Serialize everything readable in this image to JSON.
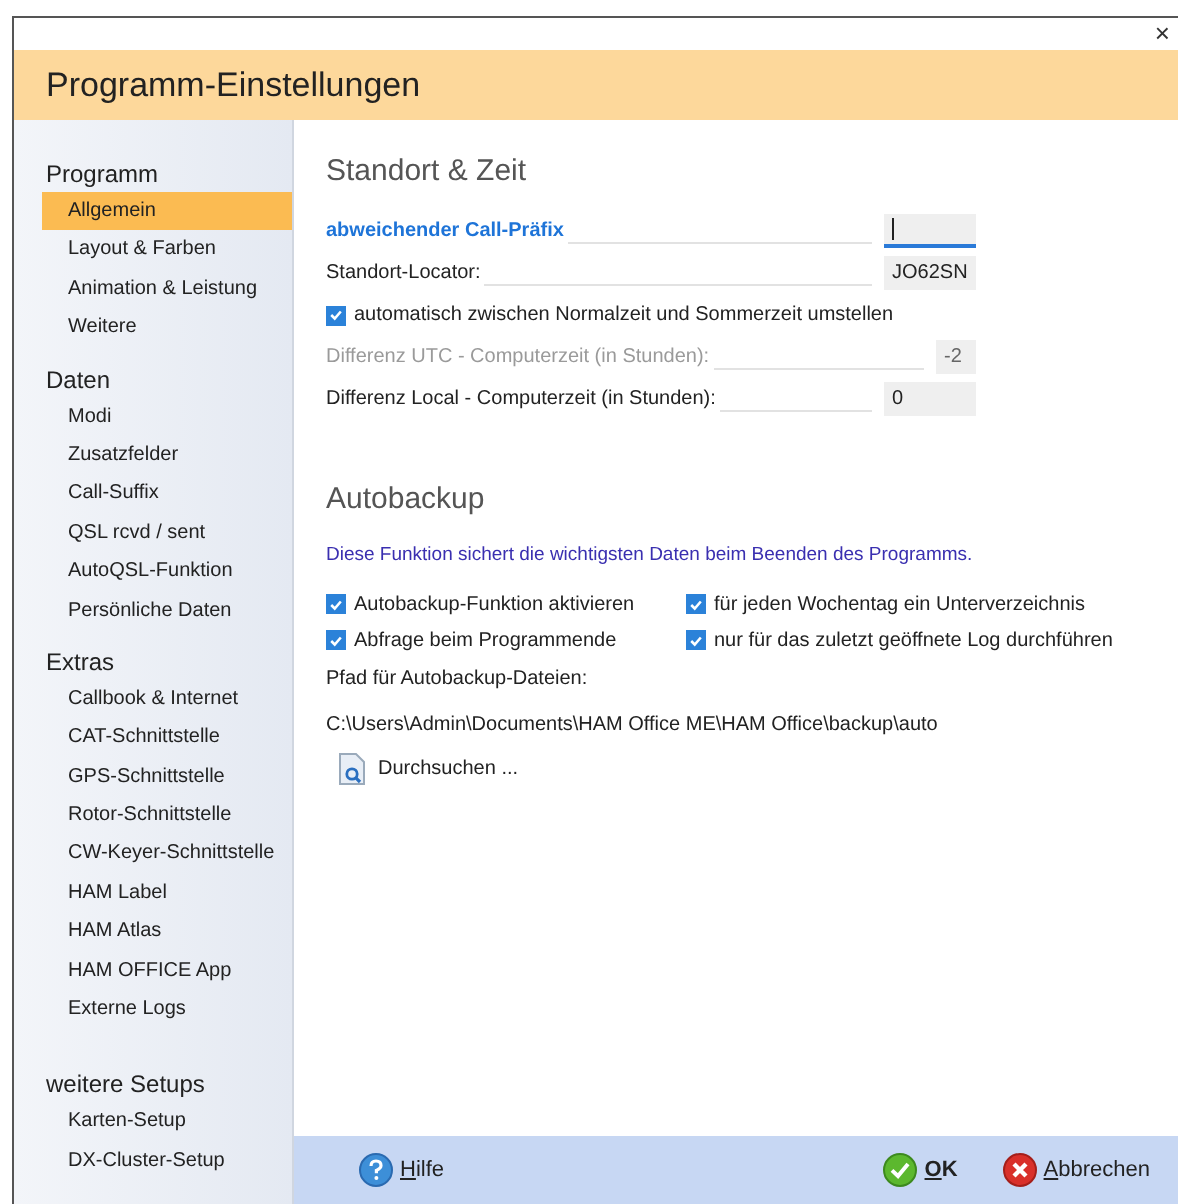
{
  "window": {
    "close": "×",
    "title": "Programm-Einstellungen"
  },
  "sidebar": {
    "groups": [
      {
        "heading": "Programm",
        "items": [
          {
            "label": "Allgemein",
            "selected": true
          },
          {
            "label": "Layout & Farben",
            "selected": false
          },
          {
            "label": "Animation & Leistung",
            "selected": false
          },
          {
            "label": "Weitere",
            "selected": false
          }
        ]
      },
      {
        "heading": "Daten",
        "items": [
          {
            "label": "Modi",
            "selected": false
          },
          {
            "label": "Zusatzfelder",
            "selected": false
          },
          {
            "label": "Call-Suffix",
            "selected": false
          },
          {
            "label": "QSL rcvd / sent",
            "selected": false
          },
          {
            "label": "AutoQSL-Funktion",
            "selected": false
          },
          {
            "label": "Persönliche Daten",
            "selected": false
          }
        ]
      },
      {
        "heading": "Extras",
        "items": [
          {
            "label": "Callbook & Internet",
            "selected": false
          },
          {
            "label": "CAT-Schnittstelle",
            "selected": false
          },
          {
            "label": "GPS-Schnittstelle",
            "selected": false
          },
          {
            "label": "Rotor-Schnittstelle",
            "selected": false
          },
          {
            "label": "CW-Keyer-Schnittstelle",
            "selected": false
          },
          {
            "label": "HAM Label",
            "selected": false
          },
          {
            "label": "HAM Atlas",
            "selected": false
          },
          {
            "label": "HAM OFFICE App",
            "selected": false
          },
          {
            "label": "Externe Logs",
            "selected": false
          }
        ]
      },
      {
        "heading": "weitere Setups",
        "items": [
          {
            "label": "Karten-Setup",
            "selected": false
          },
          {
            "label": "DX-Cluster-Setup",
            "selected": false
          }
        ]
      }
    ]
  },
  "standort": {
    "heading": "Standort & Zeit",
    "rows": [
      {
        "kind": "field",
        "label": "abweichender Call-Präfix",
        "link": true,
        "value": "",
        "focused": true,
        "disabled": false
      },
      {
        "kind": "field",
        "label": "Standort-Locator:",
        "link": false,
        "value": "JO62SN",
        "focused": false,
        "disabled": false
      },
      {
        "kind": "checkbox",
        "label": "automatisch zwischen Normalzeit und Sommerzeit umstellen",
        "checked": true
      },
      {
        "kind": "field",
        "label": "Differenz UTC - Computerzeit (in Stunden):",
        "link": false,
        "value": "-2",
        "focused": false,
        "disabled": true
      },
      {
        "kind": "field",
        "label": "Differenz Local - Computerzeit (in Stunden):",
        "link": false,
        "value": "0",
        "focused": false,
        "disabled": false
      }
    ]
  },
  "autobackup": {
    "heading": "Autobackup",
    "info": "Diese Funktion sichert die wichtigsten Daten beim Beenden des Programms.",
    "options": [
      {
        "label": "Autobackup-Funktion aktivieren",
        "checked": true
      },
      {
        "label": "für jeden Wochentag  ein Unterverzeichnis",
        "checked": true
      },
      {
        "label": "Abfrage beim Programmende",
        "checked": true
      },
      {
        "label": "nur für das zuletzt geöffnete Log durchführen",
        "checked": true
      }
    ],
    "path_label": "Pfad für Autobackup-Dateien:",
    "path": "C:\\Users\\Admin\\Documents\\HAM Office ME\\HAM Office\\backup\\auto",
    "browse": "Durchsuchen ..."
  },
  "footer": {
    "help": "Hilfe",
    "ok": "OK",
    "cancel": "Abbrechen"
  }
}
